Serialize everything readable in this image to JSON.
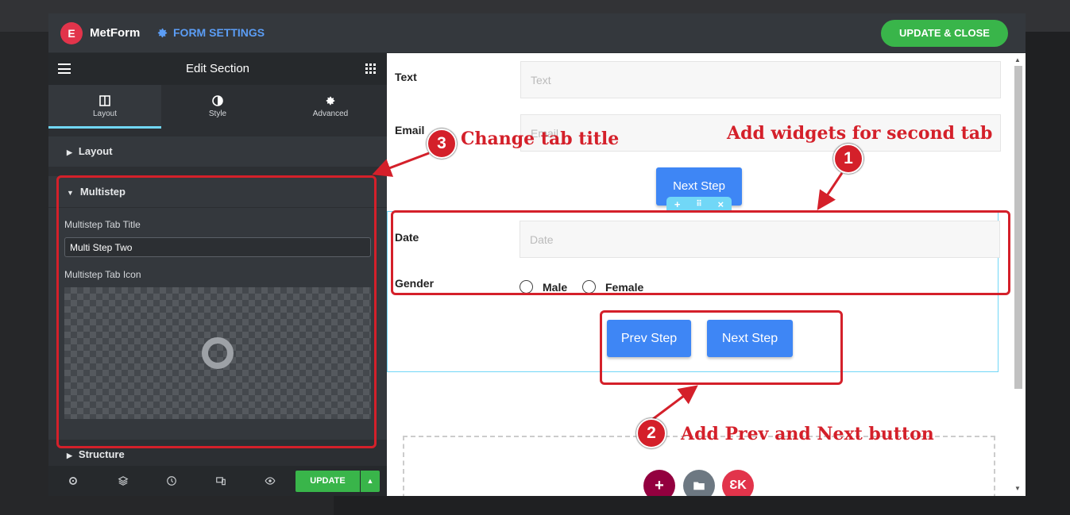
{
  "modal": {
    "brand": "MetForm",
    "logo_letter": "E",
    "form_settings": "FORM SETTINGS",
    "update_close": "UPDATE & CLOSE"
  },
  "panel": {
    "title": "Edit Section",
    "tabs": [
      {
        "label": "Layout",
        "icon": "layout-icon"
      },
      {
        "label": "Style",
        "icon": "style-icon"
      },
      {
        "label": "Advanced",
        "icon": "gear-icon"
      }
    ],
    "sections": {
      "layout": "Layout",
      "multistep": "Multistep",
      "structure": "Structure"
    },
    "tab_title_label": "Multistep Tab Title",
    "tab_title_value": "Multi Step Two",
    "tab_icon_label": "Multistep Tab Icon",
    "update": "UPDATE"
  },
  "form": {
    "text_label": "Text",
    "text_placeholder": "Text",
    "email_label": "Email",
    "email_placeholder": "Email",
    "next_step_1": "Next Step",
    "date_label": "Date",
    "date_placeholder": "Date",
    "gender_label": "Gender",
    "gender_options": [
      "Male",
      "Female"
    ],
    "prev_step": "Prev Step",
    "next_step_2": "Next Step"
  },
  "annotations": {
    "one": {
      "num": "1",
      "text": "Add widgets for second tab"
    },
    "two": {
      "num": "2",
      "text": "Add Prev and Next button"
    },
    "three": {
      "num": "3",
      "text": "Change tab title"
    }
  },
  "colors": {
    "accent_green": "#39b54a",
    "annotation_red": "#d4202a",
    "button_blue": "#3e86f5",
    "section_outline": "#71d7f7"
  }
}
